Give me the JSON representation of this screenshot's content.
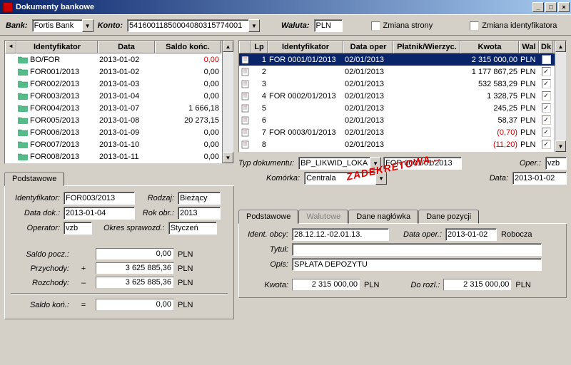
{
  "window": {
    "title": "Dokumenty bankowe"
  },
  "toolbar": {
    "bank_label": "Bank:",
    "bank_value": "Fortis Bank",
    "konto_label": "Konto:",
    "konto_value": "54160011850004080315774001",
    "waluta_label": "Waluta:",
    "waluta_value": "PLN",
    "zmiana_strony": "Zmiana strony",
    "zmiana_idf": "Zmiana identyfikatora"
  },
  "left_grid": {
    "headers": {
      "id": "Identyfikator",
      "data": "Data",
      "saldo": "Saldo końc."
    },
    "rows": [
      {
        "id": "BO/FOR",
        "data": "2013-01-02",
        "saldo": "0,00",
        "neg": true
      },
      {
        "id": "FOR001/2013",
        "data": "2013-01-02",
        "saldo": "0,00"
      },
      {
        "id": "FOR002/2013",
        "data": "2013-01-03",
        "saldo": "0,00"
      },
      {
        "id": "FOR003/2013",
        "data": "2013-01-04",
        "saldo": "0,00"
      },
      {
        "id": "FOR004/2013",
        "data": "2013-01-07",
        "saldo": "1 666,18"
      },
      {
        "id": "FOR005/2013",
        "data": "2013-01-08",
        "saldo": "20 273,15"
      },
      {
        "id": "FOR006/2013",
        "data": "2013-01-09",
        "saldo": "0,00"
      },
      {
        "id": "FOR007/2013",
        "data": "2013-01-10",
        "saldo": "0,00"
      },
      {
        "id": "FOR008/2013",
        "data": "2013-01-11",
        "saldo": "0,00"
      }
    ]
  },
  "right_grid": {
    "headers": {
      "lp": "Lp",
      "id": "Identyfikator",
      "data": "Data oper",
      "pla": "Płatnik/Wierzyc.",
      "kwota": "Kwota",
      "wal": "Wal",
      "dk": "Dk"
    },
    "rows": [
      {
        "lp": "1",
        "id": "FOR 0001/01/2013",
        "data": "02/01/2013",
        "pla": "",
        "kwota": "2 315 000,00",
        "wal": "PLN",
        "dk": true,
        "sel": true
      },
      {
        "lp": "2",
        "id": "",
        "data": "02/01/2013",
        "pla": "",
        "kwota": "1 177 867,25",
        "wal": "PLN",
        "dk": true
      },
      {
        "lp": "3",
        "id": "",
        "data": "02/01/2013",
        "pla": "",
        "kwota": "532 583,29",
        "wal": "PLN",
        "dk": true
      },
      {
        "lp": "4",
        "id": "FOR 0002/01/2013",
        "data": "02/01/2013",
        "pla": "",
        "kwota": "1 328,75",
        "wal": "PLN",
        "dk": true
      },
      {
        "lp": "5",
        "id": "",
        "data": "02/01/2013",
        "pla": "",
        "kwota": "245,25",
        "wal": "PLN",
        "dk": true
      },
      {
        "lp": "6",
        "id": "",
        "data": "02/01/2013",
        "pla": "",
        "kwota": "58,37",
        "wal": "PLN",
        "dk": true
      },
      {
        "lp": "7",
        "id": "FOR 0003/01/2013",
        "data": "02/01/2013",
        "pla": "",
        "kwota": "(0,70)",
        "wal": "PLN",
        "dk": true,
        "neg": true
      },
      {
        "lp": "8",
        "id": "",
        "data": "02/01/2013",
        "pla": "",
        "kwota": "(11,20)",
        "wal": "PLN",
        "dk": true,
        "neg": true
      }
    ]
  },
  "stamp": "ZADEKRETOWA...",
  "doc_header": {
    "typ_l": "Typ dokumentu:",
    "typ_v": "BP_LIKWID_LOKA",
    "ref_v": "FOR 0001/01/2013",
    "oper_l": "Oper.:",
    "oper_v": "vzb",
    "kom_l": "Komórka:",
    "kom_v": "Centrala",
    "data_l": "Data:",
    "data_v": "2013-01-02"
  },
  "left_form": {
    "tab": "Podstawowe",
    "idf_l": "Identyfikator:",
    "idf_v": "FOR003/2013",
    "rodz_l": "Rodzaj:",
    "rodz_v": "Bieżący",
    "dd_l": "Data dok.:",
    "dd_v": "2013-01-04",
    "ro_l": "Rok obr.:",
    "ro_v": "2013",
    "op_l": "Operator:",
    "op_v": "vzb",
    "os_l": "Okres sprawozd.:",
    "os_v": "Styczeń",
    "sp_l": "Saldo pocz.:",
    "sp_v": "0,00",
    "sp_u": "PLN",
    "pr_l": "Przychody:",
    "pr_v": "3 625 885,36",
    "pr_u": "PLN",
    "ro2_l": "Rozchody:",
    "ro2_v": "3 625 885,36",
    "ro2_u": "PLN",
    "sk_l": "Saldo koń.:",
    "sk_v": "0,00",
    "sk_u": "PLN",
    "plus": "+",
    "minus": "–",
    "eq": "="
  },
  "right_form": {
    "tabs": [
      "Podstawowe",
      "Walutowe",
      "Dane nagłówka",
      "Dane pozycji"
    ],
    "io_l": "Ident. obcy:",
    "io_v": "28.12.12.-02.01.13.",
    "do_l": "Data oper.:",
    "do_v": "2013-01-02",
    "do_suf": "Robocza",
    "ty_l": "Tytuł:",
    "ty_v": "",
    "op_l": "Opis:",
    "op_v": "SPŁATA DEPOZYTU",
    "kw_l": "Kwota:",
    "kw_v": "2 315 000,00",
    "kw_u": "PLN",
    "dr_l": "Do rozl.:",
    "dr_v": "2 315 000,00",
    "dr_u": "PLN"
  }
}
